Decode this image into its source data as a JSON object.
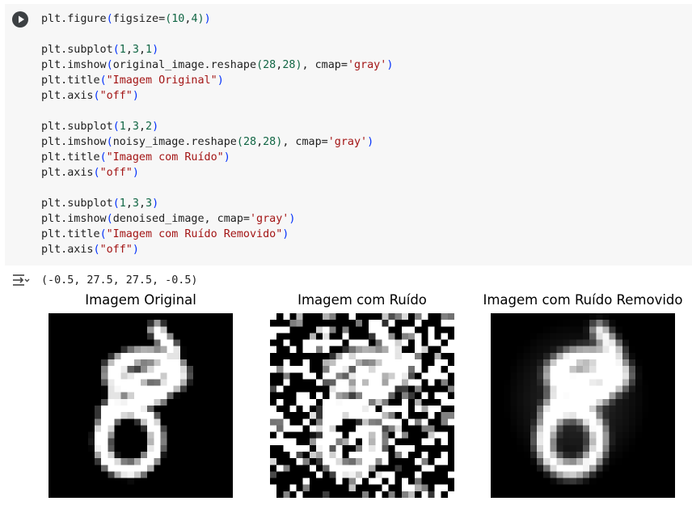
{
  "code_lines": [
    [
      [
        "plt.figure",
        ""
      ],
      [
        "(",
        "p1"
      ],
      [
        "figsize=",
        ""
      ],
      [
        "(",
        "p2"
      ],
      [
        "10",
        "num"
      ],
      [
        ",",
        ""
      ],
      [
        "4",
        "num"
      ],
      [
        ")",
        "p2"
      ],
      [
        ")",
        "p1"
      ]
    ],
    [],
    [
      [
        "plt.subplot",
        ""
      ],
      [
        "(",
        "p1"
      ],
      [
        "1",
        "num"
      ],
      [
        ",",
        ""
      ],
      [
        "3",
        "num"
      ],
      [
        ",",
        ""
      ],
      [
        "1",
        "num"
      ],
      [
        ")",
        "p1"
      ]
    ],
    [
      [
        "plt.imshow",
        ""
      ],
      [
        "(",
        "p1"
      ],
      [
        "original_image.reshape",
        ""
      ],
      [
        "(",
        "p2"
      ],
      [
        "28",
        "num"
      ],
      [
        ",",
        ""
      ],
      [
        "28",
        "num"
      ],
      [
        ")",
        "p2"
      ],
      [
        ", cmap=",
        ""
      ],
      [
        "'gray'",
        "str"
      ],
      [
        ")",
        "p1"
      ]
    ],
    [
      [
        "plt.title",
        ""
      ],
      [
        "(",
        "p1"
      ],
      [
        "\"Imagem Original\"",
        "str"
      ],
      [
        ")",
        "p1"
      ]
    ],
    [
      [
        "plt.axis",
        ""
      ],
      [
        "(",
        "p1"
      ],
      [
        "\"off\"",
        "str"
      ],
      [
        ")",
        "p1"
      ]
    ],
    [],
    [
      [
        "plt.subplot",
        ""
      ],
      [
        "(",
        "p1"
      ],
      [
        "1",
        "num"
      ],
      [
        ",",
        ""
      ],
      [
        "3",
        "num"
      ],
      [
        ",",
        ""
      ],
      [
        "2",
        "num"
      ],
      [
        ")",
        "p1"
      ]
    ],
    [
      [
        "plt.imshow",
        ""
      ],
      [
        "(",
        "p1"
      ],
      [
        "noisy_image.reshape",
        ""
      ],
      [
        "(",
        "p2"
      ],
      [
        "28",
        "num"
      ],
      [
        ",",
        ""
      ],
      [
        "28",
        "num"
      ],
      [
        ")",
        "p2"
      ],
      [
        ", cmap=",
        ""
      ],
      [
        "'gray'",
        "str"
      ],
      [
        ")",
        "p1"
      ]
    ],
    [
      [
        "plt.title",
        ""
      ],
      [
        "(",
        "p1"
      ],
      [
        "\"Imagem com Ruído\"",
        "str"
      ],
      [
        ")",
        "p1"
      ]
    ],
    [
      [
        "plt.axis",
        ""
      ],
      [
        "(",
        "p1"
      ],
      [
        "\"off\"",
        "str"
      ],
      [
        ")",
        "p1"
      ]
    ],
    [],
    [
      [
        "plt.subplot",
        ""
      ],
      [
        "(",
        "p1"
      ],
      [
        "1",
        "num"
      ],
      [
        ",",
        ""
      ],
      [
        "3",
        "num"
      ],
      [
        ",",
        ""
      ],
      [
        "3",
        "num"
      ],
      [
        ")",
        "p1"
      ]
    ],
    [
      [
        "plt.imshow",
        ""
      ],
      [
        "(",
        "p1"
      ],
      [
        "denoised_image, cmap=",
        ""
      ],
      [
        "'gray'",
        "str"
      ],
      [
        ")",
        "p1"
      ]
    ],
    [
      [
        "plt.title",
        ""
      ],
      [
        "(",
        "p1"
      ],
      [
        "\"Imagem com Ruído Removido\"",
        "str"
      ],
      [
        ")",
        "p1"
      ]
    ],
    [
      [
        "plt.axis",
        ""
      ],
      [
        "(",
        "p1"
      ],
      [
        "\"off\"",
        "str"
      ],
      [
        ")",
        "p1"
      ]
    ]
  ],
  "output": {
    "text": "(-0.5, 27.5, 27.5, -0.5)"
  },
  "panels": [
    {
      "title": "Imagem Original",
      "kind": "original"
    },
    {
      "title": "Imagem com Ruído",
      "kind": "noisy"
    },
    {
      "title": "Imagem com Ruído Removido",
      "kind": "denoised"
    }
  ],
  "icons": {
    "run": "play-circle-icon",
    "output": "output-toggle-icon"
  },
  "colors": {
    "cell_bg": "#f7f7f7",
    "number": "#116644",
    "string": "#a31515",
    "paren": "#0431fa"
  }
}
